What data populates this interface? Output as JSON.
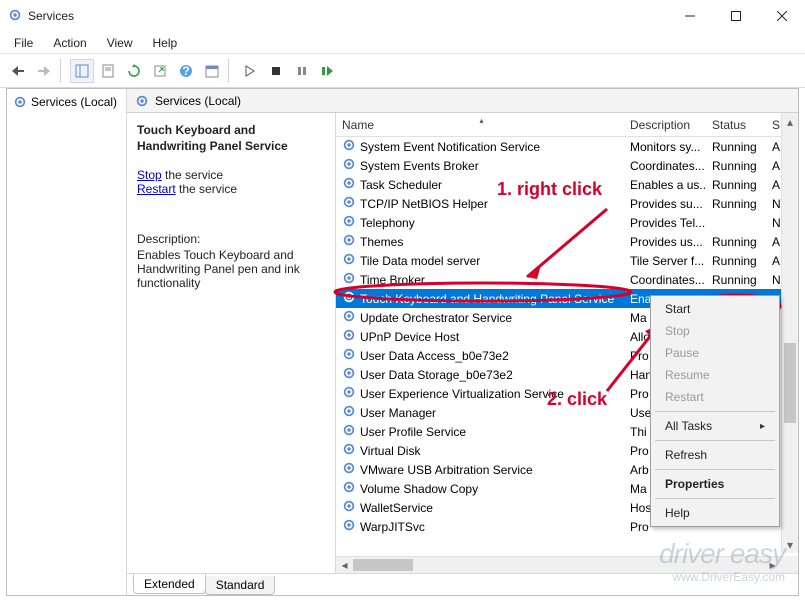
{
  "window": {
    "title": "Services"
  },
  "menu": {
    "file": "File",
    "action": "Action",
    "view": "View",
    "help": "Help"
  },
  "tree": {
    "root": "Services (Local)"
  },
  "detail": {
    "title": "Touch Keyboard and Handwriting Panel Service",
    "stop_link": "Stop",
    "stop_suffix": " the service",
    "restart_link": "Restart",
    "restart_suffix": " the service",
    "desc_label": "Description:",
    "desc_text": "Enables Touch Keyboard and Handwriting Panel pen and ink functionality"
  },
  "columns": {
    "name": "Name",
    "description": "Description",
    "status": "Status",
    "extra": "S"
  },
  "services": [
    {
      "name": "System Event Notification Service",
      "desc": "Monitors sy...",
      "status": "Running",
      "extra": "A"
    },
    {
      "name": "System Events Broker",
      "desc": "Coordinates...",
      "status": "Running",
      "extra": "A"
    },
    {
      "name": "Task Scheduler",
      "desc": "Enables a us...",
      "status": "Running",
      "extra": "A"
    },
    {
      "name": "TCP/IP NetBIOS Helper",
      "desc": "Provides su...",
      "status": "Running",
      "extra": "N"
    },
    {
      "name": "Telephony",
      "desc": "Provides Tel...",
      "status": "",
      "extra": "N"
    },
    {
      "name": "Themes",
      "desc": "Provides us...",
      "status": "Running",
      "extra": "A"
    },
    {
      "name": "Tile Data model server",
      "desc": "Tile Server f...",
      "status": "Running",
      "extra": "A"
    },
    {
      "name": "Time Broker",
      "desc": "Coordinates...",
      "status": "Running",
      "extra": "N"
    },
    {
      "name": "Touch Keyboard and Handwriting Panel Service",
      "desc": "Ena",
      "status": "",
      "extra": "",
      "selected": true
    },
    {
      "name": "Update Orchestrator Service",
      "desc": "Ma",
      "status": "",
      "extra": ""
    },
    {
      "name": "UPnP Device Host",
      "desc": "Allo",
      "status": "",
      "extra": ""
    },
    {
      "name": "User Data Access_b0e73e2",
      "desc": "Pro",
      "status": "",
      "extra": ""
    },
    {
      "name": "User Data Storage_b0e73e2",
      "desc": "Han",
      "status": "",
      "extra": ""
    },
    {
      "name": "User Experience Virtualization Service",
      "desc": "Pro",
      "status": "",
      "extra": ""
    },
    {
      "name": "User Manager",
      "desc": "Use",
      "status": "",
      "extra": ""
    },
    {
      "name": "User Profile Service",
      "desc": "Thi",
      "status": "",
      "extra": ""
    },
    {
      "name": "Virtual Disk",
      "desc": "Pro",
      "status": "",
      "extra": ""
    },
    {
      "name": "VMware USB Arbitration Service",
      "desc": "Arb",
      "status": "",
      "extra": ""
    },
    {
      "name": "Volume Shadow Copy",
      "desc": "Ma",
      "status": "",
      "extra": ""
    },
    {
      "name": "WalletService",
      "desc": "Hos",
      "status": "",
      "extra": ""
    },
    {
      "name": "WarpJITSvc",
      "desc": "Pro",
      "status": "",
      "extra": ""
    }
  ],
  "tabs": {
    "extended": "Extended",
    "standard": "Standard"
  },
  "contextmenu": {
    "start": "Start",
    "stop": "Stop",
    "pause": "Pause",
    "resume": "Resume",
    "restart": "Restart",
    "all_tasks": "All Tasks",
    "refresh": "Refresh",
    "properties": "Properties",
    "help": "Help"
  },
  "annotations": {
    "step1": "1. right  click",
    "step2": "2. click"
  },
  "watermark": {
    "line1": "driver easy",
    "line2": "www.DriverEasy.com"
  }
}
